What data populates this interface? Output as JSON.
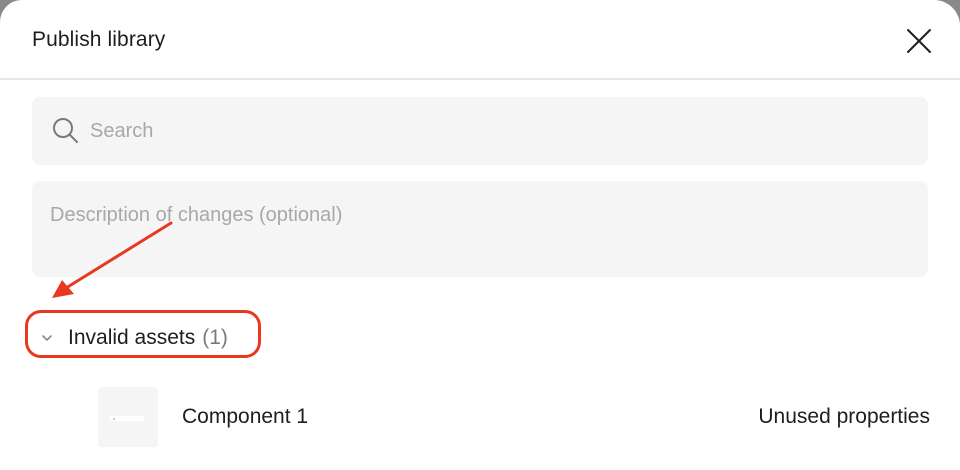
{
  "dialog": {
    "title": "Publish library",
    "close_icon": "close-icon"
  },
  "search": {
    "placeholder": "Search",
    "value": "",
    "icon": "search-icon"
  },
  "description": {
    "placeholder": "Description of changes (optional)",
    "value": ""
  },
  "invalid_section": {
    "label": "Invalid assets",
    "count": "(1)",
    "icon": "chevron-down-icon",
    "expanded": true
  },
  "assets": [
    {
      "name": "Component 1",
      "status": "Unused properties"
    }
  ],
  "annotation": {
    "highlight_color": "#e8381f",
    "arrow_color": "#e8381f"
  }
}
